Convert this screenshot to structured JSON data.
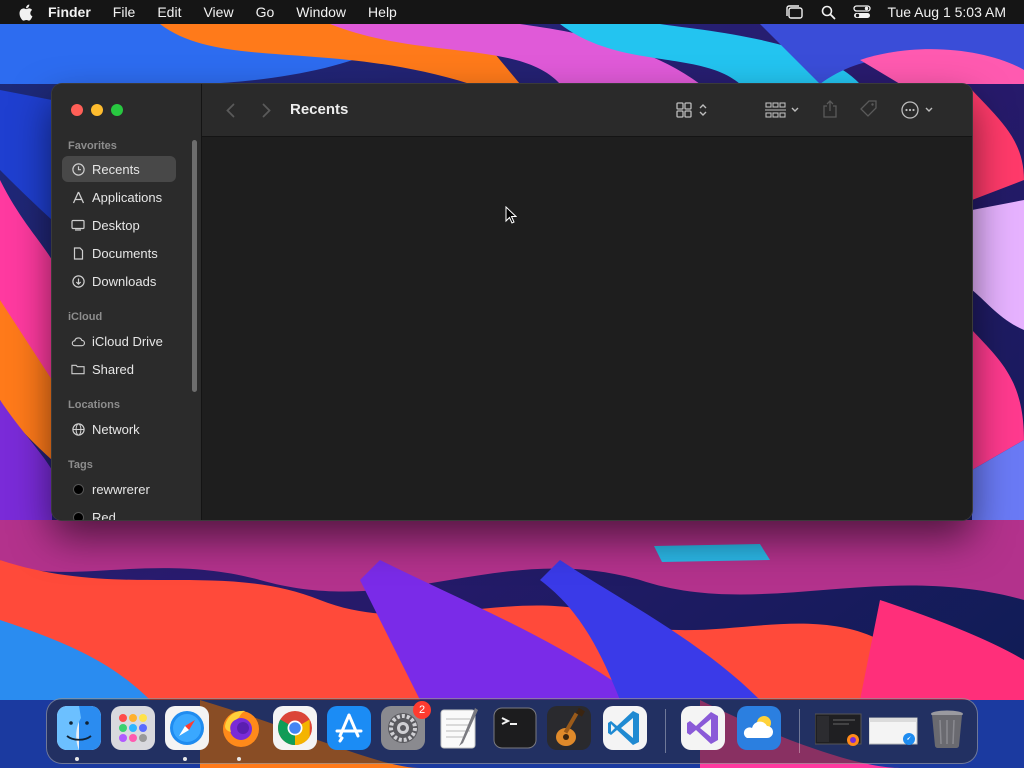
{
  "menubar": {
    "app_name": "Finder",
    "items": [
      "File",
      "Edit",
      "View",
      "Go",
      "Window",
      "Help"
    ],
    "clock": "Tue Aug 1  5:03 AM",
    "status_icons": [
      "stage-manager-icon",
      "spotlight-search-icon",
      "control-center-icon"
    ]
  },
  "finder": {
    "title": "Recents",
    "sidebar": {
      "sections": {
        "favorites": "Favorites",
        "icloud": "iCloud",
        "locations": "Locations",
        "tags": "Tags"
      },
      "favorites": [
        {
          "label": "Recents",
          "icon": "clock-icon",
          "selected": true
        },
        {
          "label": "Applications",
          "icon": "applications-icon"
        },
        {
          "label": "Desktop",
          "icon": "desktop-icon"
        },
        {
          "label": "Documents",
          "icon": "document-icon"
        },
        {
          "label": "Downloads",
          "icon": "download-icon"
        }
      ],
      "icloud": [
        {
          "label": "iCloud Drive",
          "icon": "cloud-icon"
        },
        {
          "label": "Shared",
          "icon": "shared-folder-icon"
        }
      ],
      "locations": [
        {
          "label": "Network",
          "icon": "globe-icon"
        }
      ],
      "tags": [
        {
          "label": "rewwrerer",
          "color": "#000000"
        },
        {
          "label": "Red",
          "color": "#000000"
        }
      ]
    },
    "toolbar_icons": [
      "back-icon",
      "forward-icon",
      "view-mode-icon",
      "group-icon",
      "share-icon",
      "tag-icon",
      "more-actions-icon",
      "search-icon"
    ]
  },
  "dock": {
    "apps": [
      {
        "name": "Finder",
        "icon": "finder-icon",
        "running": true
      },
      {
        "name": "Launchpad",
        "icon": "launchpad-icon"
      },
      {
        "name": "Safari",
        "icon": "safari-icon",
        "running": true
      },
      {
        "name": "Firefox",
        "icon": "firefox-icon",
        "running": true
      },
      {
        "name": "Chrome",
        "icon": "chrome-icon"
      },
      {
        "name": "App Store",
        "icon": "app-store-icon"
      },
      {
        "name": "System Settings",
        "icon": "system-settings-icon",
        "badge": "2"
      },
      {
        "name": "TextEdit",
        "icon": "textedit-icon"
      },
      {
        "name": "Terminal",
        "icon": "terminal-icon"
      },
      {
        "name": "GarageBand",
        "icon": "garageband-icon"
      },
      {
        "name": "Visual Studio Code",
        "icon": "vscode-icon"
      },
      {
        "name": "Visual Studio",
        "icon": "visual-studio-icon"
      },
      {
        "name": "Weather",
        "icon": "weather-icon"
      }
    ],
    "recents": [
      "recent-window-firefox-icon",
      "recent-window-safari-icon"
    ],
    "trash": "trash-icon"
  }
}
